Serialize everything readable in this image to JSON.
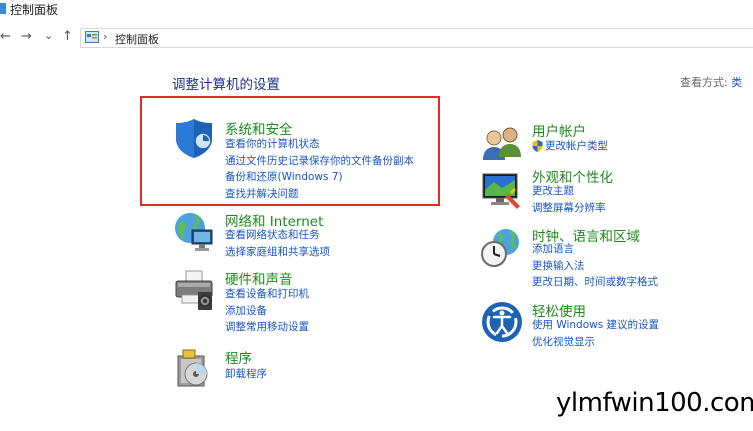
{
  "window": {
    "title": "控制面板"
  },
  "nav": {
    "back": "←",
    "forward": "→",
    "recent": "⌄",
    "up": "↑",
    "address": "控制面板",
    "refresh": "⌄"
  },
  "main": {
    "heading": "调整计算机的设置",
    "view_by_label": "查看方式:",
    "view_by_value": "类"
  },
  "categories": [
    {
      "title": "系统和安全",
      "links": [
        "查看你的计算机状态",
        "通过文件历史记录保存你的文件备份副本",
        "备份和还原(Windows 7)",
        "查找并解决问题"
      ]
    },
    {
      "title": "网络和 Internet",
      "links": [
        "查看网络状态和任务",
        "选择家庭组和共享选项"
      ]
    },
    {
      "title": "硬件和声音",
      "links": [
        "查看设备和打印机",
        "添加设备",
        "调整常用移动设置"
      ]
    },
    {
      "title": "程序",
      "links": [
        "卸载程序"
      ]
    },
    {
      "title": "用户帐户",
      "links": [
        "更改帐户类型"
      ]
    },
    {
      "title": "外观和个性化",
      "links": [
        "更改主题",
        "调整屏幕分辨率"
      ]
    },
    {
      "title": "时钟、语言和区域",
      "links": [
        "添加语言",
        "更换输入法",
        "更改日期、时间或数字格式"
      ]
    },
    {
      "title": "轻松使用",
      "links": [
        "使用 Windows 建议的设置",
        "优化视觉显示"
      ]
    }
  ],
  "watermark": "ylmfwin100.com",
  "colors": {
    "title_green": "#1e8a1e",
    "link_blue": "#1a55c0",
    "heading_blue": "#1e3287",
    "highlight_red": "#e02b2b"
  }
}
